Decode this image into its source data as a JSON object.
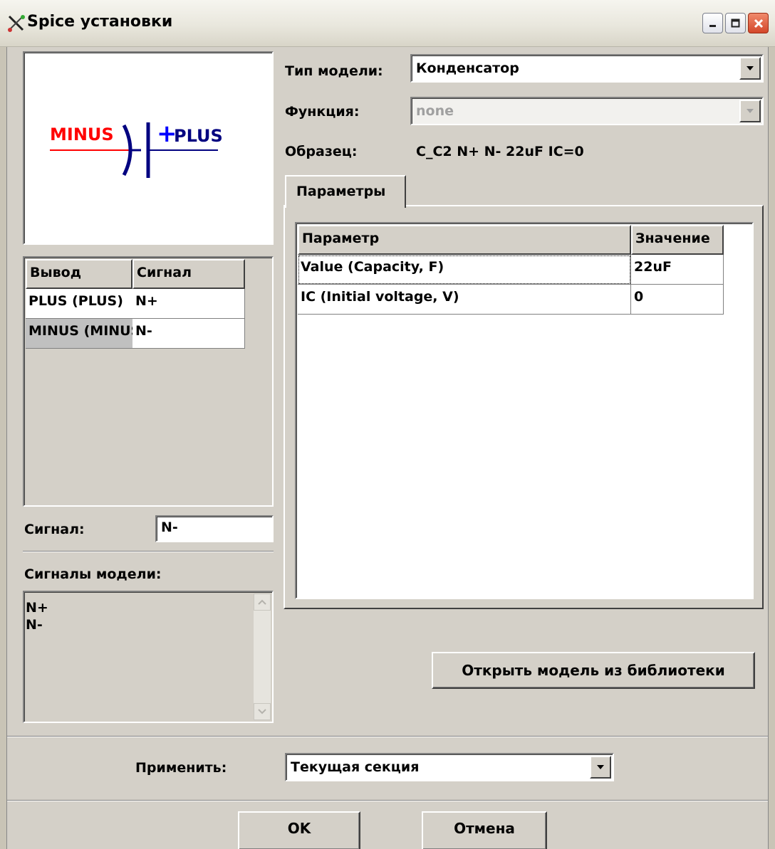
{
  "window": {
    "title": "Spice установки",
    "icon": "probe-icon"
  },
  "symbol": {
    "pin_left": "MINUS",
    "pin_right": "PLUS",
    "polarity": "+",
    "colors": {
      "minus": "#ff0000",
      "plus": "#0000ff",
      "body": "#000080"
    }
  },
  "pins_table": {
    "headers": [
      "Вывод",
      "Сигнал"
    ],
    "rows": [
      {
        "pin": "PLUS (PLUS)",
        "signal": "N+"
      },
      {
        "pin": "MINUS (MINUS)",
        "signal": "N-"
      }
    ]
  },
  "signal_field": {
    "label": "Сигнал:",
    "value": "N-"
  },
  "model_signals": {
    "label": "Сигналы модели:",
    "items": [
      "N+",
      "N-"
    ]
  },
  "model_type": {
    "label": "Тип модели:",
    "value": "Конденсатор"
  },
  "function": {
    "label": "Функция:",
    "value": "none"
  },
  "sample": {
    "label": "Образец:",
    "value": "C_C2 N+ N- 22uF IC=0"
  },
  "params_tab": {
    "label": "Параметры"
  },
  "params_table": {
    "headers": [
      "Параметр",
      "Значение"
    ],
    "rows": [
      {
        "name": "Value (Capacity, F)",
        "value": "22uF"
      },
      {
        "name": "IC (Initial voltage, V)",
        "value": "0"
      }
    ]
  },
  "open_model_button": "Открыть модель из библиотеки",
  "apply": {
    "label": "Применить:",
    "value": "Текущая секция"
  },
  "ok_button": "OK",
  "cancel_button": "Отмена"
}
